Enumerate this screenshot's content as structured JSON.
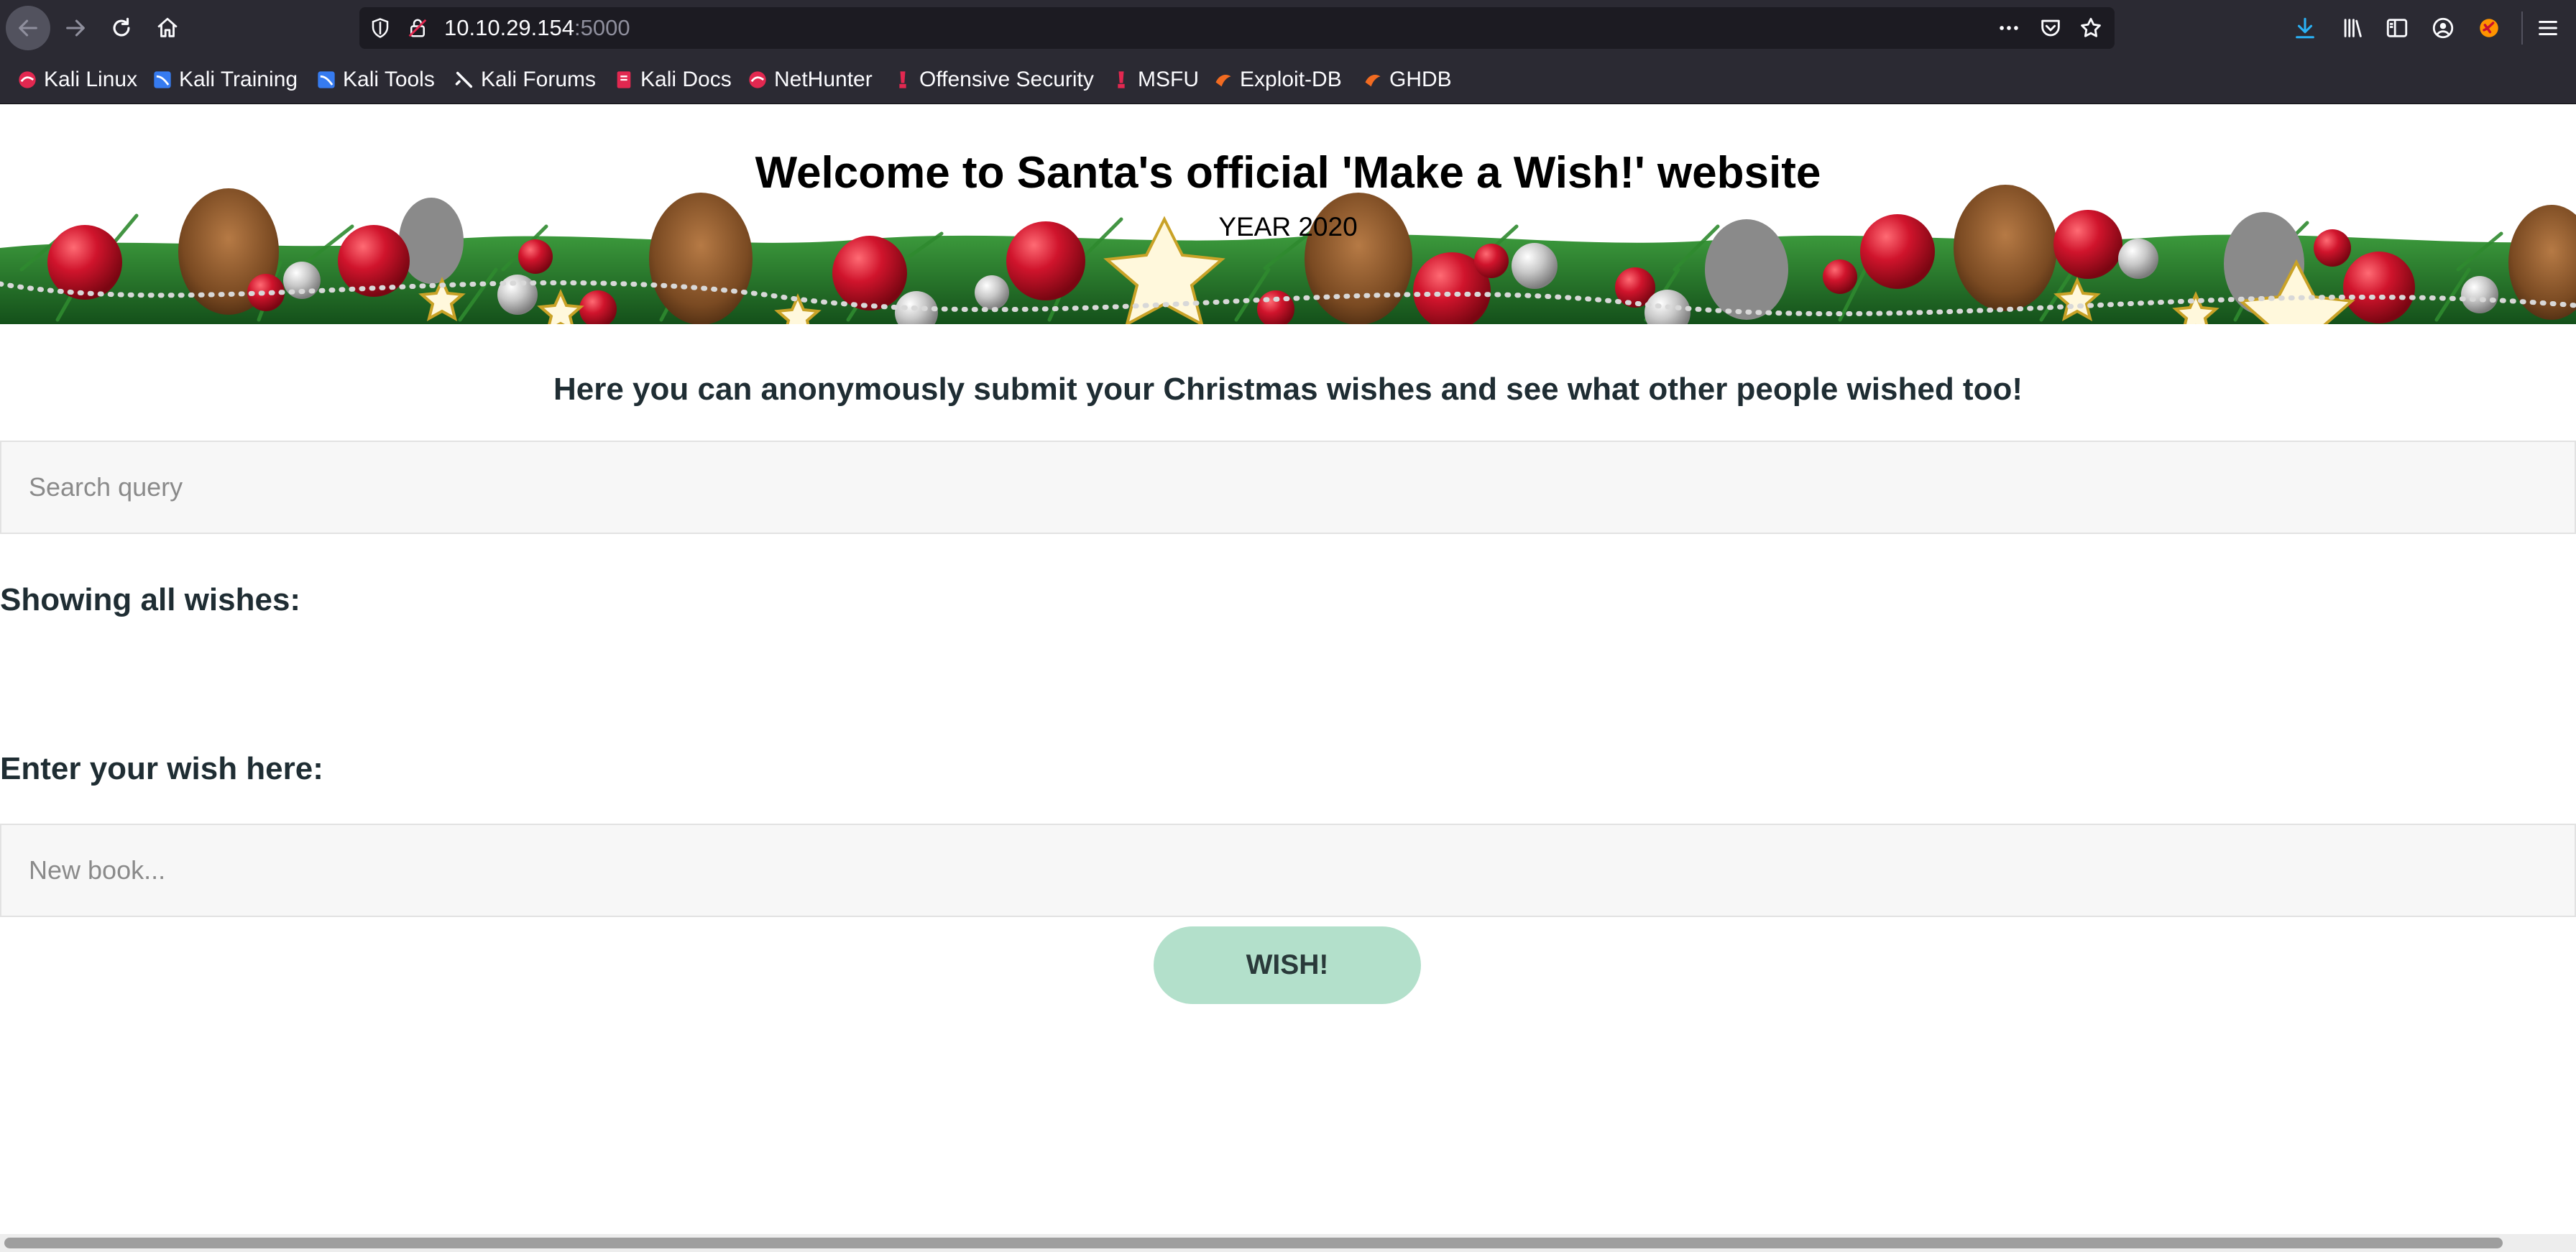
{
  "browser": {
    "url_host": "10.10.29.154",
    "url_port": ":5000",
    "icons": {
      "back": "arrow-left-icon",
      "forward": "arrow-right-icon",
      "reload": "reload-icon",
      "home": "home-icon",
      "page_actions": "more-horizontal-icon",
      "pocket": "pocket-icon",
      "bookmark_star": "star-icon",
      "downloads": "download-icon",
      "library": "library-icon",
      "sidebar": "sidebar-icon",
      "account": "account-icon",
      "extension": "extension-icon",
      "menu": "hamburger-menu-icon"
    }
  },
  "bookmarks": [
    {
      "label": "Kali Linux",
      "icon": "kali-dragon-icon"
    },
    {
      "label": "Kali Training",
      "icon": "kali-training-icon"
    },
    {
      "label": "Kali Tools",
      "icon": "kali-tools-icon"
    },
    {
      "label": "Kali Forums",
      "icon": "kali-forums-icon"
    },
    {
      "label": "Kali Docs",
      "icon": "kali-docs-icon"
    },
    {
      "label": "NetHunter",
      "icon": "nethunter-icon"
    },
    {
      "label": "Offensive Security",
      "icon": "offsec-icon"
    },
    {
      "label": "MSFU",
      "icon": "msfu-icon"
    },
    {
      "label": "Exploit-DB",
      "icon": "exploit-db-icon"
    },
    {
      "label": "GHDB",
      "icon": "ghdb-icon"
    }
  ],
  "page": {
    "title": "Welcome to Santa's official 'Make a Wish!' website",
    "subtitle": "YEAR 2020",
    "intro": "Here you can anonymously submit your Christmas wishes and see what other people wished too!",
    "search": {
      "placeholder": "Search query",
      "value": ""
    },
    "showing_heading": "Showing all wishes:",
    "wishes": [],
    "enter_heading": "Enter your wish here:",
    "wish_input": {
      "placeholder": "New book...",
      "value": ""
    },
    "submit_label": "WISH!"
  },
  "colors": {
    "chrome_bg": "#2b2a33",
    "urlbar_bg": "#1c1b22",
    "heading_text": "#1f2d33",
    "button_bg": "#b3e0cb",
    "field_bg": "#f7f7f7",
    "ornament_red": "#c8102e",
    "garland_green": "#2e7d32"
  }
}
